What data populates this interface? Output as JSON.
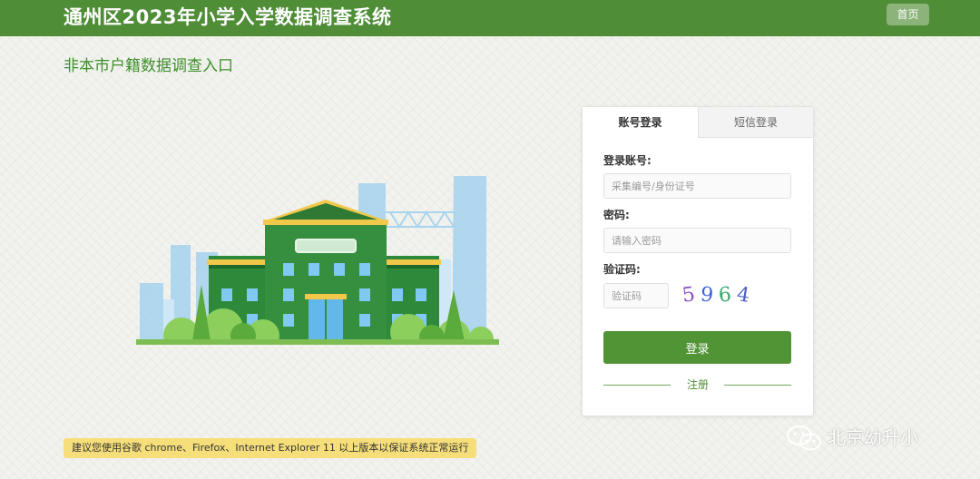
{
  "header": {
    "title": "通州区2023年小学入学数据调查系统",
    "home_label": "首页"
  },
  "page": {
    "subtitle": "非本市户籍数据调查入口"
  },
  "login": {
    "tabs": [
      "账号登录",
      "短信登录"
    ],
    "active_tab": "账号登录",
    "account_label": "登录账号:",
    "account_placeholder": "采集编号/身份证号",
    "password_label": "密码:",
    "password_placeholder": "请输入密码",
    "captcha_label": "验证码:",
    "captcha_placeholder": "验证码",
    "captcha_digits": [
      "5",
      "9",
      "6",
      "4"
    ],
    "submit_label": "登录",
    "register_label": "注册"
  },
  "notice": {
    "text": "建议您使用谷歌 chrome、Firefox、Internet Explorer 11 以上版本以保证系统正常运行"
  },
  "watermark": {
    "text": "北京幼升小",
    "icon": "wechat-icon"
  },
  "colors": {
    "brand": "#4f8d37",
    "button": "#519436",
    "notice_bg": "#f6df7a",
    "captcha": [
      "#8a4fc8",
      "#3c64d8",
      "#3aa86b",
      "#4a5fc4"
    ]
  }
}
